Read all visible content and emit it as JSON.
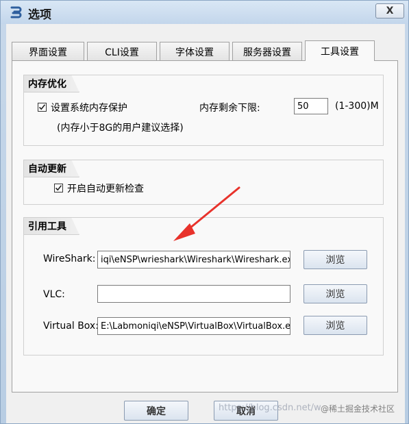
{
  "window": {
    "title": "选项",
    "close_label": "X"
  },
  "tabs": [
    {
      "label": "界面设置"
    },
    {
      "label": "CLI设置"
    },
    {
      "label": "字体设置"
    },
    {
      "label": "服务器设置"
    },
    {
      "label": "工具设置",
      "active": true
    }
  ],
  "memory": {
    "title": "内存优化",
    "protect_label": "设置系统内存保护",
    "protect_checked": true,
    "hint": "(内存小于8G的用户建议选择)",
    "lower_limit_label": "内存剩余下限:",
    "lower_limit_value": "50",
    "range_label": "(1-300)M"
  },
  "update": {
    "title": "自动更新",
    "auto_check_label": "开启自动更新检查",
    "auto_check_checked": true
  },
  "tools": {
    "title": "引用工具",
    "browse_label": "浏览",
    "wireshark": {
      "label": "WireShark:",
      "value": "iqi\\eNSP\\wrieshark\\Wireshark\\Wireshark.exe"
    },
    "vlc": {
      "label": "VLC:",
      "value": ""
    },
    "virtualbox": {
      "label": "Virtual Box:",
      "value": "E:\\Labmoniqi\\eNSP\\VirtualBox\\VirtualBox.exe"
    }
  },
  "footer": {
    "ok_label": "确定",
    "cancel_label": "取消"
  },
  "watermark": {
    "left": "https://blog.csdn.net/w",
    "right": "@稀土掘金技术社区"
  },
  "colors": {
    "annotation_arrow": "#e8322b"
  }
}
